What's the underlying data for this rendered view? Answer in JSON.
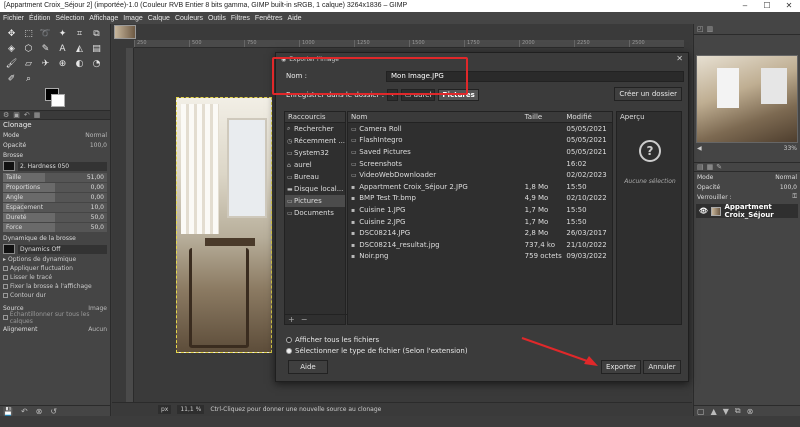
{
  "window": {
    "title": "[Appartment Croix_Séjour 2] (importée)-1.0 (Couleur RVB Entier 8 bits gamma, GIMP built-in sRGB, 1 calque) 3264x1836 – GIMP"
  },
  "menu": [
    "Fichier",
    "Édition",
    "Sélection",
    "Affichage",
    "Image",
    "Calque",
    "Couleurs",
    "Outils",
    "Filtres",
    "Fenêtres",
    "Aide"
  ],
  "ruler": [
    "250",
    "500",
    "750",
    "1000",
    "1250",
    "1500",
    "1750",
    "2000",
    "2250",
    "2500"
  ],
  "tool_options": {
    "title": "Clonage",
    "mode_label": "Mode",
    "mode_value": "Normal",
    "opacity_label": "Opacité",
    "opacity_value": "100,0",
    "brush_label": "Brosse",
    "brush_value": "2. Hardness 050",
    "size_label": "Taille",
    "size_value": "51,00",
    "ratio_label": "Proportions",
    "ratio_value": "0,00",
    "angle_label": "Angle",
    "angle_value": "0,00",
    "spacing_label": "Espacement",
    "spacing_value": "10,0",
    "hardness_label": "Dureté",
    "hardness_value": "50,0",
    "force_label": "Force",
    "force_value": "50,0",
    "dynamics_label": "Dynamique de la brosse",
    "dynamics_value": "Dynamics Off",
    "dyn_options": "Options de dynamique",
    "jitter": "Appliquer fluctuation",
    "smooth": "Lisser le tracé",
    "lock_brush": "Fixer la brosse à l'affichage",
    "hard_edge": "Contour dur",
    "source_label": "Source",
    "source_value": "Image",
    "sample_merged": "Échantillonner sur tous les calques",
    "align_label": "Alignement",
    "align_value": "Aucun"
  },
  "status": {
    "unit": "px",
    "zoom": "11,1 %",
    "message": "Ctrl-Cliquez pour donner une nouvelle source au clonage"
  },
  "navigator": {
    "zoom": "33%"
  },
  "layers": {
    "mode_label": "Mode",
    "mode_value": "Normal",
    "opacity_label": "Opacité",
    "opacity_value": "100,0",
    "lock_label": "Verrouiller :",
    "layer_name": "Appartment Croix_Séjour"
  },
  "dialog": {
    "title": "Exporter l'image",
    "name_label": "Nom :",
    "name_value": "Mon Image.JPG",
    "folder_label": "Enregistrer dans le dossier :",
    "crumbs": [
      "aurel",
      "Pictures"
    ],
    "create_folder": "Créer un dossier",
    "places_header": "Raccourcis",
    "places": [
      "Rechercher",
      "Récemment ...",
      "System32",
      "aurel",
      "Bureau",
      "Disque local...",
      "Pictures",
      "Documents"
    ],
    "columns": {
      "name": "Nom",
      "size": "Taille",
      "modified": "Modifié"
    },
    "files": [
      {
        "name": "Camera Roll",
        "size": "",
        "modified": "05/05/2021"
      },
      {
        "name": "FlashIntegro",
        "size": "",
        "modified": "05/05/2021"
      },
      {
        "name": "Saved Pictures",
        "size": "",
        "modified": "05/05/2021"
      },
      {
        "name": "Screenshots",
        "size": "",
        "modified": "16:02"
      },
      {
        "name": "VideoWebDownloader",
        "size": "",
        "modified": "02/02/2023"
      },
      {
        "name": "Appartment Croix_Séjour 2.JPG",
        "size": "1,8 Mo",
        "modified": "15:50"
      },
      {
        "name": "BMP Test Tr.bmp",
        "size": "4,9 Mo",
        "modified": "02/10/2022"
      },
      {
        "name": "Cuisine 1.JPG",
        "size": "1,7 Mo",
        "modified": "15:50"
      },
      {
        "name": "Cuisine 2.JPG",
        "size": "1,7 Mo",
        "modified": "15:50"
      },
      {
        "name": "DSC08214.JPG",
        "size": "2,8 Mo",
        "modified": "26/03/2017"
      },
      {
        "name": "DSC08214_resultat.jpg",
        "size": "737,4 ko",
        "modified": "21/10/2022"
      },
      {
        "name": "Noir.png",
        "size": "759 octets",
        "modified": "09/03/2022"
      }
    ],
    "preview_header": "Aperçu",
    "no_selection": "Aucune sélection",
    "show_all": "Afficher tous les fichiers",
    "select_type": "Sélectionner le type de fichier (Selon l'extension)",
    "help": "Aide",
    "export": "Exporter",
    "cancel": "Annuler"
  },
  "colors": {
    "highlight": "#e0282a",
    "arrow": "#e0282a"
  }
}
